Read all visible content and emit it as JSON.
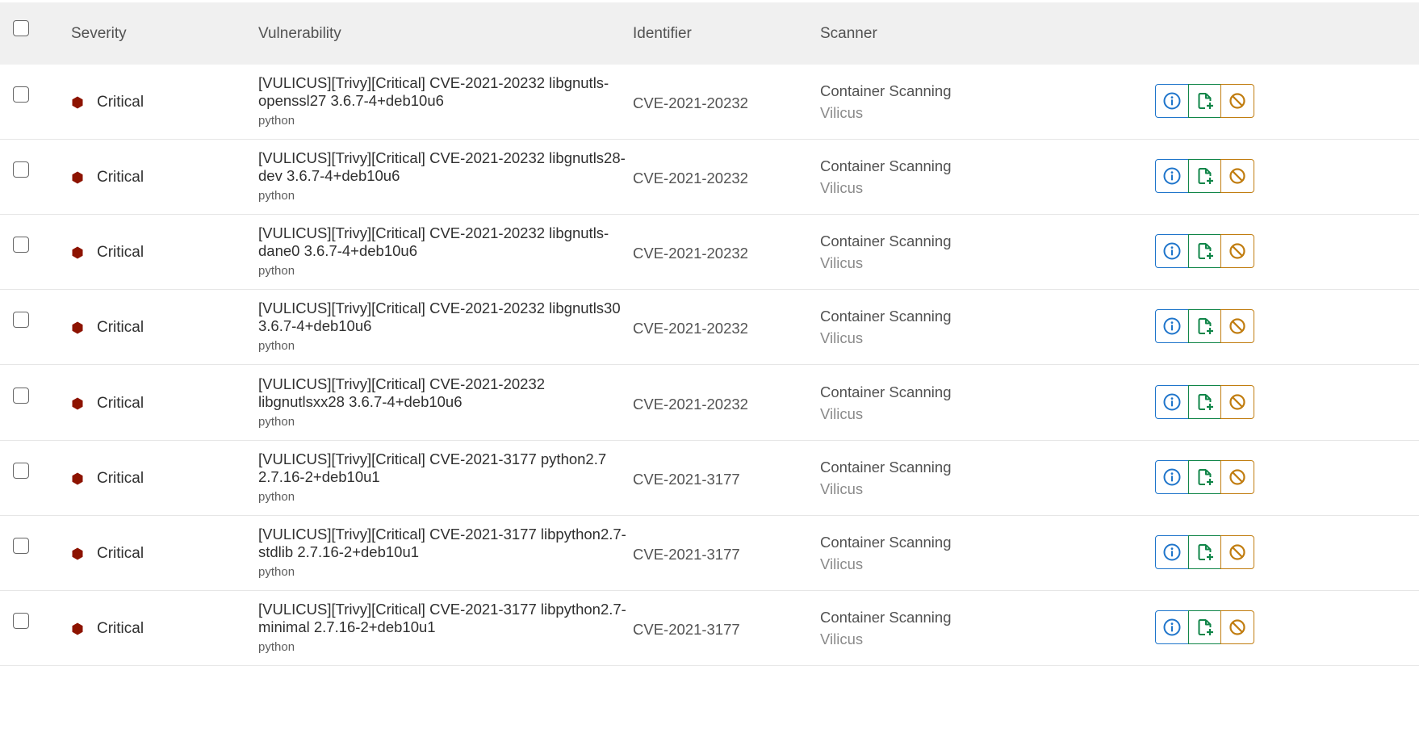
{
  "header": {
    "severity": "Severity",
    "vulnerability": "Vulnerability",
    "identifier": "Identifier",
    "scanner": "Scanner"
  },
  "colors": {
    "critical": "#8d1300",
    "info_button": "#1f75cb",
    "issue_button": "#108548",
    "dismiss_button": "#c17d10",
    "header_bg": "#f0f0f0"
  },
  "icons": {
    "severity": "critical-hexagon-icon",
    "info": "information-circle-icon",
    "issue": "issue-new-icon",
    "dismiss": "cancel-icon"
  },
  "rows": [
    {
      "severity": "Critical",
      "title": "[VULICUS][Trivy][Critical] CVE-2021-20232 libgnutls-openssl27 3.6.7-4+deb10u6",
      "subtitle": "python",
      "identifier": "CVE-2021-20232",
      "scanner": "Container Scanning",
      "vendor": "Vilicus"
    },
    {
      "severity": "Critical",
      "title": "[VULICUS][Trivy][Critical] CVE-2021-20232 libgnutls28-dev 3.6.7-4+deb10u6",
      "subtitle": "python",
      "identifier": "CVE-2021-20232",
      "scanner": "Container Scanning",
      "vendor": "Vilicus"
    },
    {
      "severity": "Critical",
      "title": "[VULICUS][Trivy][Critical] CVE-2021-20232 libgnutls-dane0 3.6.7-4+deb10u6",
      "subtitle": "python",
      "identifier": "CVE-2021-20232",
      "scanner": "Container Scanning",
      "vendor": "Vilicus"
    },
    {
      "severity": "Critical",
      "title": "[VULICUS][Trivy][Critical] CVE-2021-20232 libgnutls30 3.6.7-4+deb10u6",
      "subtitle": "python",
      "identifier": "CVE-2021-20232",
      "scanner": "Container Scanning",
      "vendor": "Vilicus"
    },
    {
      "severity": "Critical",
      "title": "[VULICUS][Trivy][Critical] CVE-2021-20232 libgnutlsxx28 3.6.7-4+deb10u6",
      "subtitle": "python",
      "identifier": "CVE-2021-20232",
      "scanner": "Container Scanning",
      "vendor": "Vilicus"
    },
    {
      "severity": "Critical",
      "title": "[VULICUS][Trivy][Critical] CVE-2021-3177 python2.7 2.7.16-2+deb10u1",
      "subtitle": "python",
      "identifier": "CVE-2021-3177",
      "scanner": "Container Scanning",
      "vendor": "Vilicus"
    },
    {
      "severity": "Critical",
      "title": "[VULICUS][Trivy][Critical] CVE-2021-3177 libpython2.7-stdlib 2.7.16-2+deb10u1",
      "subtitle": "python",
      "identifier": "CVE-2021-3177",
      "scanner": "Container Scanning",
      "vendor": "Vilicus"
    },
    {
      "severity": "Critical",
      "title": "[VULICUS][Trivy][Critical] CVE-2021-3177 libpython2.7-minimal 2.7.16-2+deb10u1",
      "subtitle": "python",
      "identifier": "CVE-2021-3177",
      "scanner": "Container Scanning",
      "vendor": "Vilicus"
    }
  ]
}
